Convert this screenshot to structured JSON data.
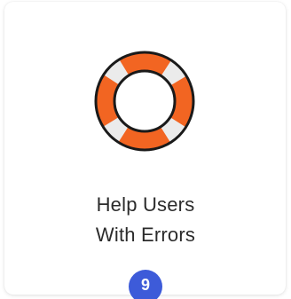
{
  "card": {
    "title_line1": "Help Users",
    "title_line2": "With Errors",
    "icon": "lifebuoy-icon",
    "badge_count": "9"
  },
  "colors": {
    "lifebuoy_orange": "#f26522",
    "lifebuoy_white": "#ebebeb",
    "outline": "#1a1a1a",
    "badge": "#3d5bd9"
  }
}
